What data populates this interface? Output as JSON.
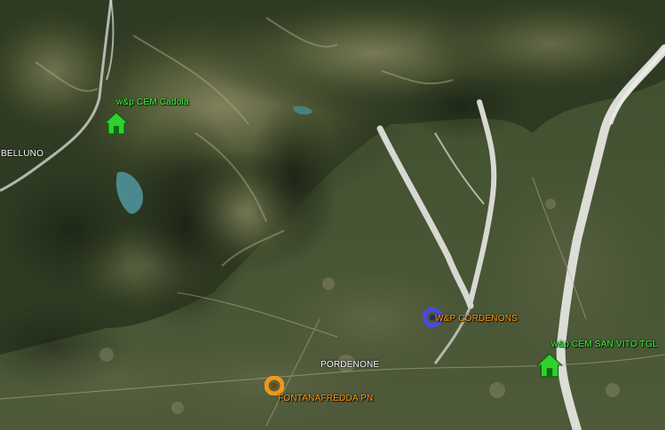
{
  "map": {
    "cities": [
      {
        "id": "belluno",
        "name": "BELLUNO"
      },
      {
        "id": "pordenone",
        "name": "PORDENONE"
      }
    ],
    "sites": [
      {
        "id": "cadola",
        "label": "w&p CEM Cadola",
        "icon": "green-house-icon",
        "color": "#2fd12f",
        "label_color": "#33ff33"
      },
      {
        "id": "cordenons",
        "label": "W&P CORDENONS",
        "icon": "blue-circle-icon",
        "color": "#4a4ae0",
        "label_color": "#ff9a1a"
      },
      {
        "id": "san-vito",
        "label": "w&p CEM SAN VITO TGL",
        "icon": "green-house-icon",
        "color": "#2fd12f",
        "label_color": "#33ff33"
      },
      {
        "id": "fontanafredda",
        "label": "FONTANAFREDDA PN",
        "icon": "orange-circle-icon",
        "color": "#f29a12",
        "label_color": "#ff9a1a"
      }
    ]
  }
}
